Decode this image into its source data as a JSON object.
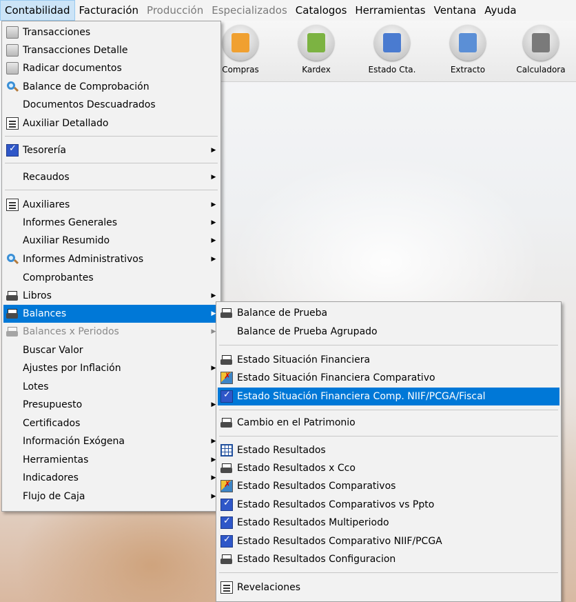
{
  "menubar": {
    "items": [
      {
        "label": "Contabilidad",
        "state": "active"
      },
      {
        "label": "Facturación",
        "state": "normal"
      },
      {
        "label": "Producción",
        "state": "disabled"
      },
      {
        "label": "Especializados",
        "state": "disabled"
      },
      {
        "label": "Catalogos",
        "state": "normal"
      },
      {
        "label": "Herramientas",
        "state": "normal"
      },
      {
        "label": "Ventana",
        "state": "normal"
      },
      {
        "label": "Ayuda",
        "state": "normal"
      }
    ]
  },
  "toolbar": {
    "buttons": [
      {
        "label": "Compras",
        "icon": "truck-icon",
        "color": "#f0a030"
      },
      {
        "label": "Kardex",
        "icon": "clipboard-add-icon",
        "color": "#7cb342"
      },
      {
        "label": "Estado Cta.",
        "icon": "id-card-icon",
        "color": "#4a7bd0"
      },
      {
        "label": "Extracto",
        "icon": "document-back-icon",
        "color": "#5b8fd6"
      },
      {
        "label": "Calculadora",
        "icon": "calculator-icon",
        "color": "#7a7a7a"
      }
    ]
  },
  "main_menu": {
    "items": [
      {
        "label": "Transacciones",
        "icon": "gray-document-icon"
      },
      {
        "label": "Transacciones Detalle",
        "icon": "gray-document-icon"
      },
      {
        "label": "Radicar documentos",
        "icon": "gray-document-icon"
      },
      {
        "label": "Balance de Comprobación",
        "icon": "magnifier-icon"
      },
      {
        "label": "Documentos Descuadrados",
        "icon": ""
      },
      {
        "label": "Auxiliar Detallado",
        "icon": "ledger-icon"
      },
      {
        "label": "Tesorería",
        "icon": "checklist-icon",
        "submenu": true
      },
      {
        "label": "Recaudos",
        "icon": "",
        "submenu": true
      },
      {
        "label": "Auxiliares",
        "icon": "ledger-icon",
        "submenu": true
      },
      {
        "label": "Informes Generales",
        "icon": "",
        "submenu": true
      },
      {
        "label": "Auxiliar Resumido",
        "icon": "",
        "submenu": true
      },
      {
        "label": "Informes Administrativos",
        "icon": "magnifier-icon",
        "submenu": true
      },
      {
        "label": "Comprobantes",
        "icon": ""
      },
      {
        "label": "Libros",
        "icon": "printer-icon",
        "submenu": true
      },
      {
        "label": "Balances",
        "icon": "printer-icon",
        "submenu": true,
        "state": "highlighted"
      },
      {
        "label": "Balances x Periodos",
        "icon": "printer-icon",
        "submenu": true,
        "state": "disabled"
      },
      {
        "label": "Buscar Valor",
        "icon": ""
      },
      {
        "label": "Ajustes por Inflación",
        "icon": "",
        "submenu": true
      },
      {
        "label": "Lotes",
        "icon": ""
      },
      {
        "label": "Presupuesto",
        "icon": "",
        "submenu": true
      },
      {
        "label": "Certificados",
        "icon": ""
      },
      {
        "label": "Información Exógena",
        "icon": "",
        "submenu": true
      },
      {
        "label": "Herramientas",
        "icon": "",
        "submenu": true
      },
      {
        "label": "Indicadores",
        "icon": "",
        "submenu": true
      },
      {
        "label": "Flujo de Caja",
        "icon": "",
        "submenu": true
      }
    ]
  },
  "balances_submenu": {
    "items": [
      {
        "label": "Balance de Prueba",
        "icon": "printer-icon"
      },
      {
        "label": "Balance de Prueba Agrupado",
        "icon": ""
      },
      {
        "label": "Estado Situación Financiera",
        "icon": "printer-icon"
      },
      {
        "label": "Estado Situación Financiera Comparativo",
        "icon": "compare-icon"
      },
      {
        "label": "Estado Situación Financiera Comp. NIIF/PCGA/Fiscal",
        "icon": "checklist-icon",
        "state": "highlighted"
      },
      {
        "label": "Cambio en el Patrimonio",
        "icon": "printer-icon"
      },
      {
        "label": "Estado Resultados",
        "icon": "grid-icon"
      },
      {
        "label": "Estado Resultados x Cco",
        "icon": "printer-icon"
      },
      {
        "label": "Estado Resultados Comparativos",
        "icon": "compare-icon"
      },
      {
        "label": "Estado Resultados Comparativos vs Ppto",
        "icon": "checklist-icon"
      },
      {
        "label": "Estado Resultados Multiperiodo",
        "icon": "checklist-icon"
      },
      {
        "label": "Estado Resultados Comparativo NIIF/PCGA",
        "icon": "checklist-icon"
      },
      {
        "label": "Estado Resultados Configuracion",
        "icon": "printer-icon"
      },
      {
        "label": "Revelaciones",
        "icon": "ledger-icon"
      }
    ]
  },
  "colors": {
    "highlight": "#0078d7",
    "menu_bg": "#f2f2f2",
    "active_menubar": "#cce4f7"
  }
}
